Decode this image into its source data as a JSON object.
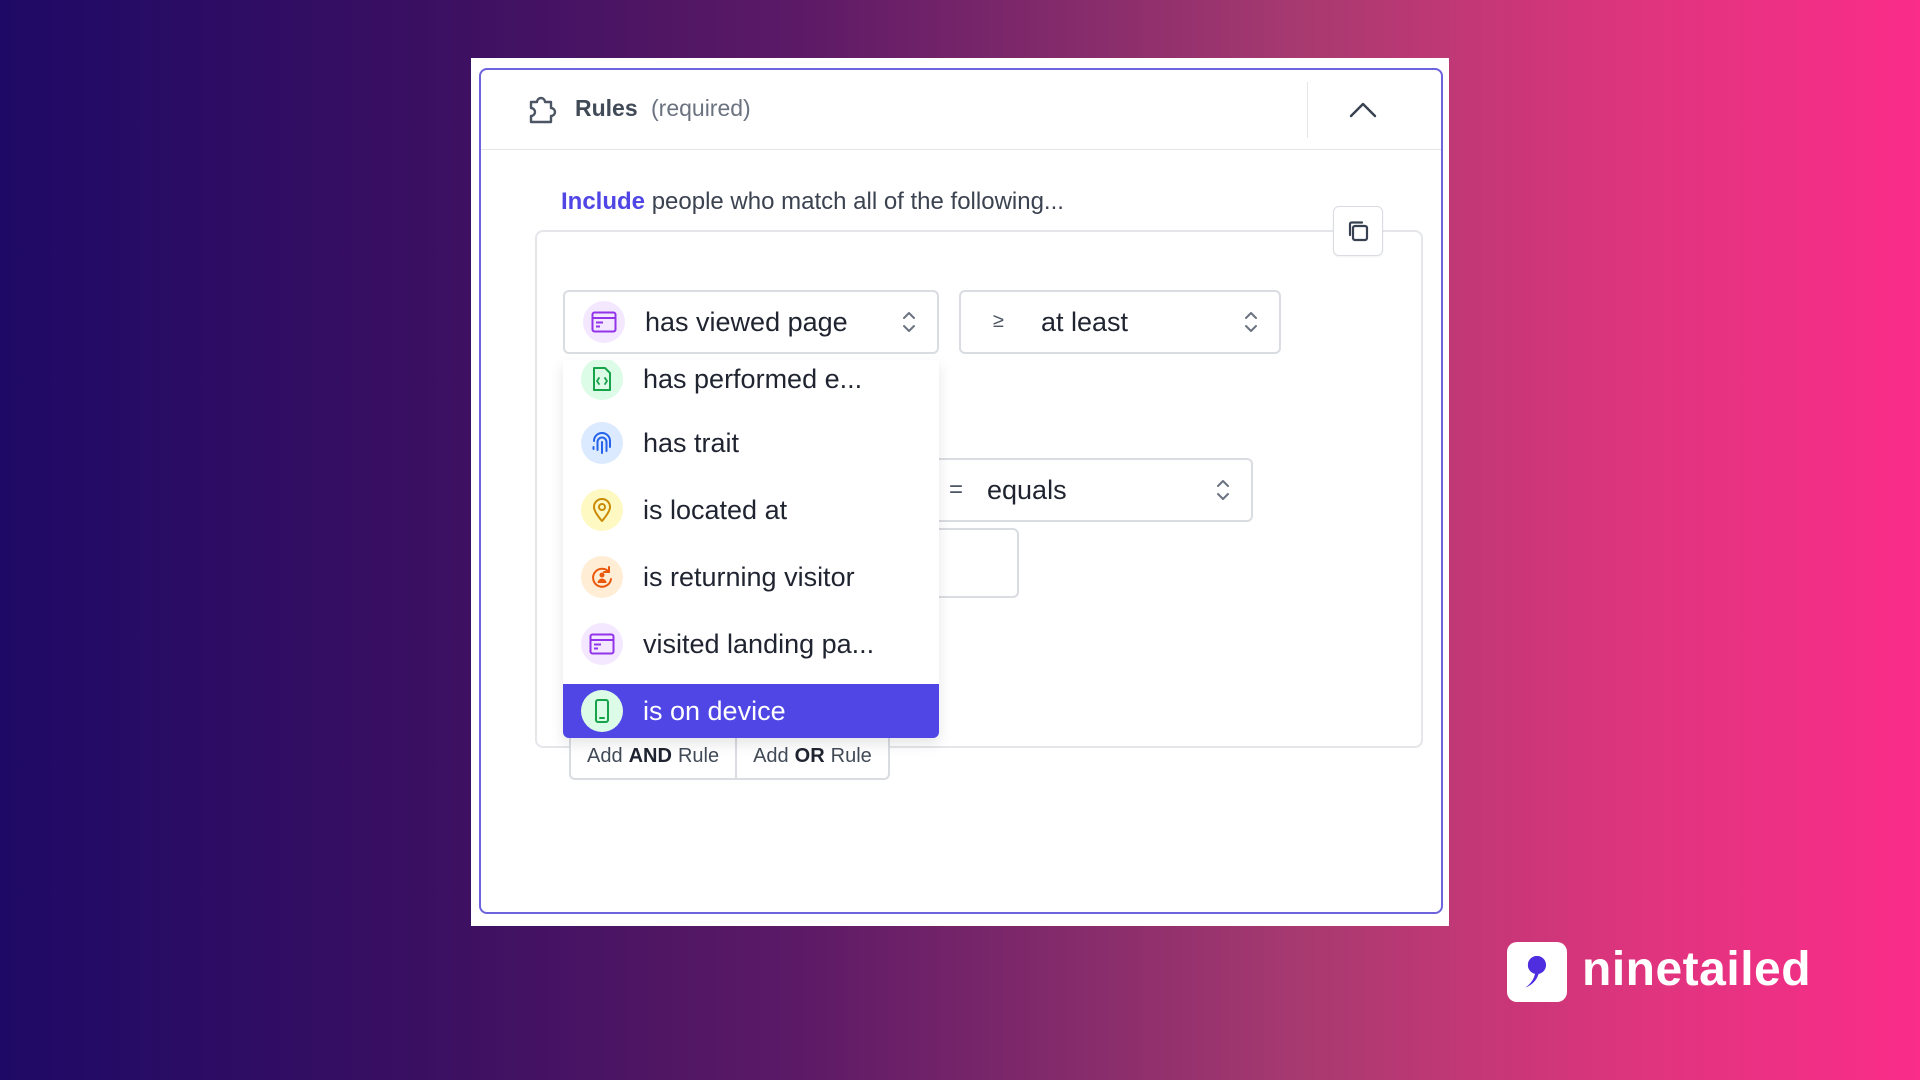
{
  "header": {
    "title": "Rules",
    "required": "(required)",
    "icon": "puzzle-icon",
    "collapse_icon": "chevron-up-icon"
  },
  "include": {
    "keyword": "Include",
    "rest": "people who match all of the following..."
  },
  "rule": {
    "condition_select": {
      "label": "has viewed page",
      "icon": "browser-window-icon"
    },
    "operator_select": {
      "symbol": "≥",
      "label": "at least"
    },
    "second_operator_select": {
      "symbol": "=",
      "label": "equals"
    }
  },
  "dropdown": {
    "items": [
      {
        "label": "has performed e...",
        "icon": "document-code-icon"
      },
      {
        "label": "has trait",
        "icon": "fingerprint-icon"
      },
      {
        "label": "is located at",
        "icon": "map-pin-icon"
      },
      {
        "label": "is returning visitor",
        "icon": "returning-visitor-icon"
      },
      {
        "label": "visited landing pa...",
        "icon": "browser-window-icon"
      },
      {
        "label": "is on device",
        "icon": "mobile-device-icon",
        "selected": true
      }
    ]
  },
  "actions": {
    "add_and_prefix": "Add",
    "add_and_bold": "AND",
    "add_and_suffix": "Rule",
    "add_or_prefix": "Add",
    "add_or_bold": "OR",
    "add_or_suffix": "Rule"
  },
  "brand": {
    "name": "ninetailed"
  },
  "colors": {
    "accent": "#4f46e5",
    "card_border": "#6c63dd",
    "background_start": "#1e0a66",
    "background_end": "#fb2c8a"
  }
}
